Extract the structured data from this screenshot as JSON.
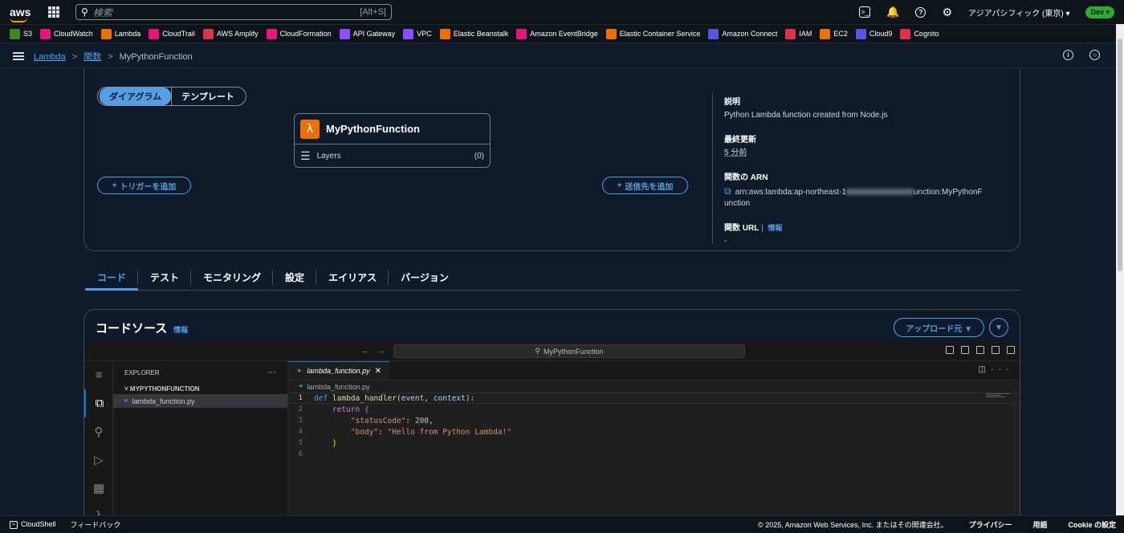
{
  "topbar": {
    "logo": "aws",
    "search_placeholder": "検索",
    "search_shortcut": "[Alt+S]",
    "region": "アジアパシフィック (東京) ▾",
    "account": "Dev ▾"
  },
  "favorites": [
    {
      "label": "S3",
      "color": "#3f8624"
    },
    {
      "label": "CloudWatch",
      "color": "#e7157b"
    },
    {
      "label": "Lambda",
      "color": "#ed7100"
    },
    {
      "label": "CloudTrail",
      "color": "#e7157b"
    },
    {
      "label": "AWS Amplify",
      "color": "#dd344c"
    },
    {
      "label": "CloudFormation",
      "color": "#e7157b"
    },
    {
      "label": "API Gateway",
      "color": "#8c4fff"
    },
    {
      "label": "VPC",
      "color": "#8c4fff"
    },
    {
      "label": "Elastic Beanstalk",
      "color": "#ed7100"
    },
    {
      "label": "Amazon EventBridge",
      "color": "#e7157b"
    },
    {
      "label": "Elastic Container Service",
      "color": "#ed7100"
    },
    {
      "label": "Amazon Connect",
      "color": "#5a55e0"
    },
    {
      "label": "IAM",
      "color": "#dd344c"
    },
    {
      "label": "EC2",
      "color": "#ed7100"
    },
    {
      "label": "Cloud9",
      "color": "#5a55e0"
    },
    {
      "label": "Cognito",
      "color": "#dd344c"
    }
  ],
  "breadcrumb": {
    "service": "Lambda",
    "section": "関数",
    "current": "MyPythonFunction"
  },
  "overview": {
    "segment_diagram": "ダイアグラム",
    "segment_template": "テンプレート",
    "function_name": "MyPythonFunction",
    "layers_label": "Layers",
    "layers_count": "(0)",
    "add_trigger": "トリガーを追加",
    "add_destination": "送信先を追加"
  },
  "details": {
    "description_label": "説明",
    "description_value": "Python Lambda function created from Node.js",
    "last_modified_label": "最終更新",
    "last_modified_value": "5 分前",
    "arn_label": "関数の ARN",
    "arn_prefix": "arn:aws:lambda:ap-northeast-1",
    "arn_suffix": "unction:MyPythonF",
    "arn_line2": "unction",
    "url_label": "関数 URL",
    "url_info": "情報",
    "url_value": "-"
  },
  "tabs": [
    "コード",
    "テスト",
    "モニタリング",
    "設定",
    "エイリアス",
    "バージョン"
  ],
  "code_source": {
    "title": "コードソース",
    "info": "情報",
    "upload_button": "アップロード元 ▼",
    "dropdown_button": "▼"
  },
  "ide": {
    "command_center": "MyPythonFunction",
    "explorer_title": "EXPLORER",
    "folder": "MYPYTHONFUNCTION",
    "file": "lambda_function.py",
    "tab_file": "lambda_function.py",
    "crumb_file": "lambda_function.py",
    "line_numbers": [
      "1",
      "2",
      "3",
      "4",
      "5",
      "6"
    ]
  },
  "footer": {
    "cloudshell": "CloudShell",
    "feedback": "フィードバック",
    "copyright": "© 2025, Amazon Web Services, Inc. またはその関連会社。",
    "privacy": "プライバシー",
    "terms": "用語",
    "cookie": "Cookie の設定"
  }
}
